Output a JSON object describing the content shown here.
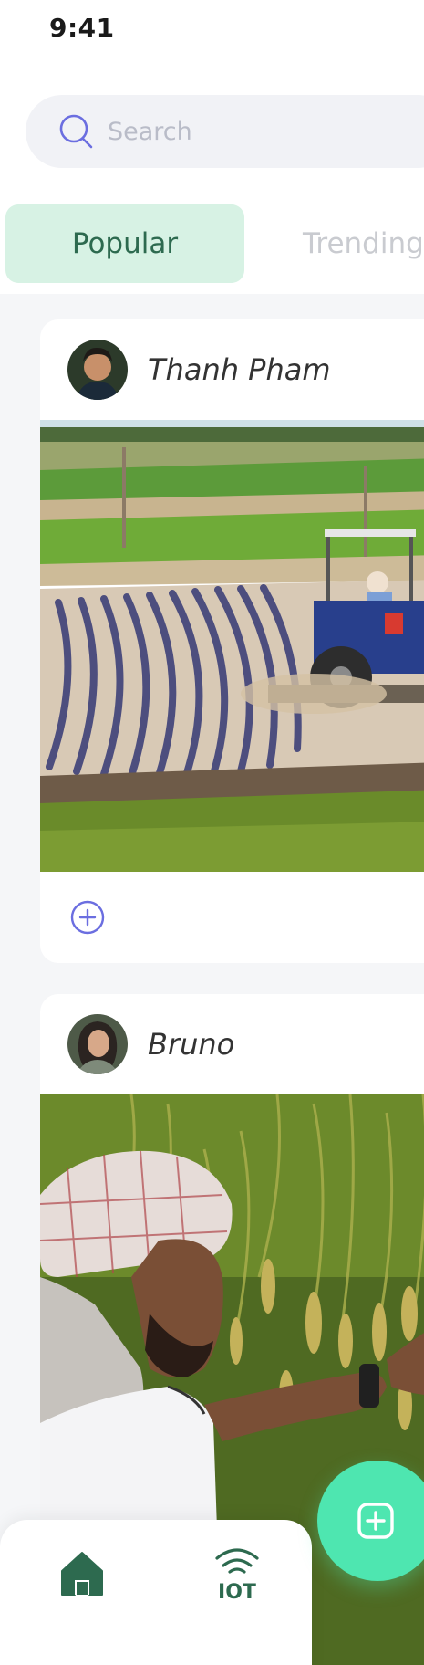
{
  "status_bar": {
    "time": "9:41"
  },
  "search": {
    "placeholder": "Search",
    "icon": "search-icon"
  },
  "tabs": [
    {
      "label": "Popular",
      "active": true
    },
    {
      "label": "Trending",
      "active": false
    }
  ],
  "posts": [
    {
      "author": "Thanh Pham",
      "image": "tractor-plowing-field",
      "action_icon": "add-circle-icon"
    },
    {
      "author": "Bruno",
      "image": "farmer-inspecting-rice",
      "action_icon": "add-circle-icon"
    }
  ],
  "bottom_nav": {
    "items": [
      {
        "icon": "home-icon",
        "active": true
      },
      {
        "icon": "iot-icon",
        "label": "IOT",
        "active": false
      }
    ]
  },
  "fab": {
    "icon": "plus-icon"
  },
  "colors": {
    "accent": "#4ee6b0",
    "tab_active_bg": "#d7f2e4",
    "tab_active_text": "#2d6a4f",
    "nav_icon": "#2d6a4f",
    "icon_purple": "#6b6ee0"
  }
}
